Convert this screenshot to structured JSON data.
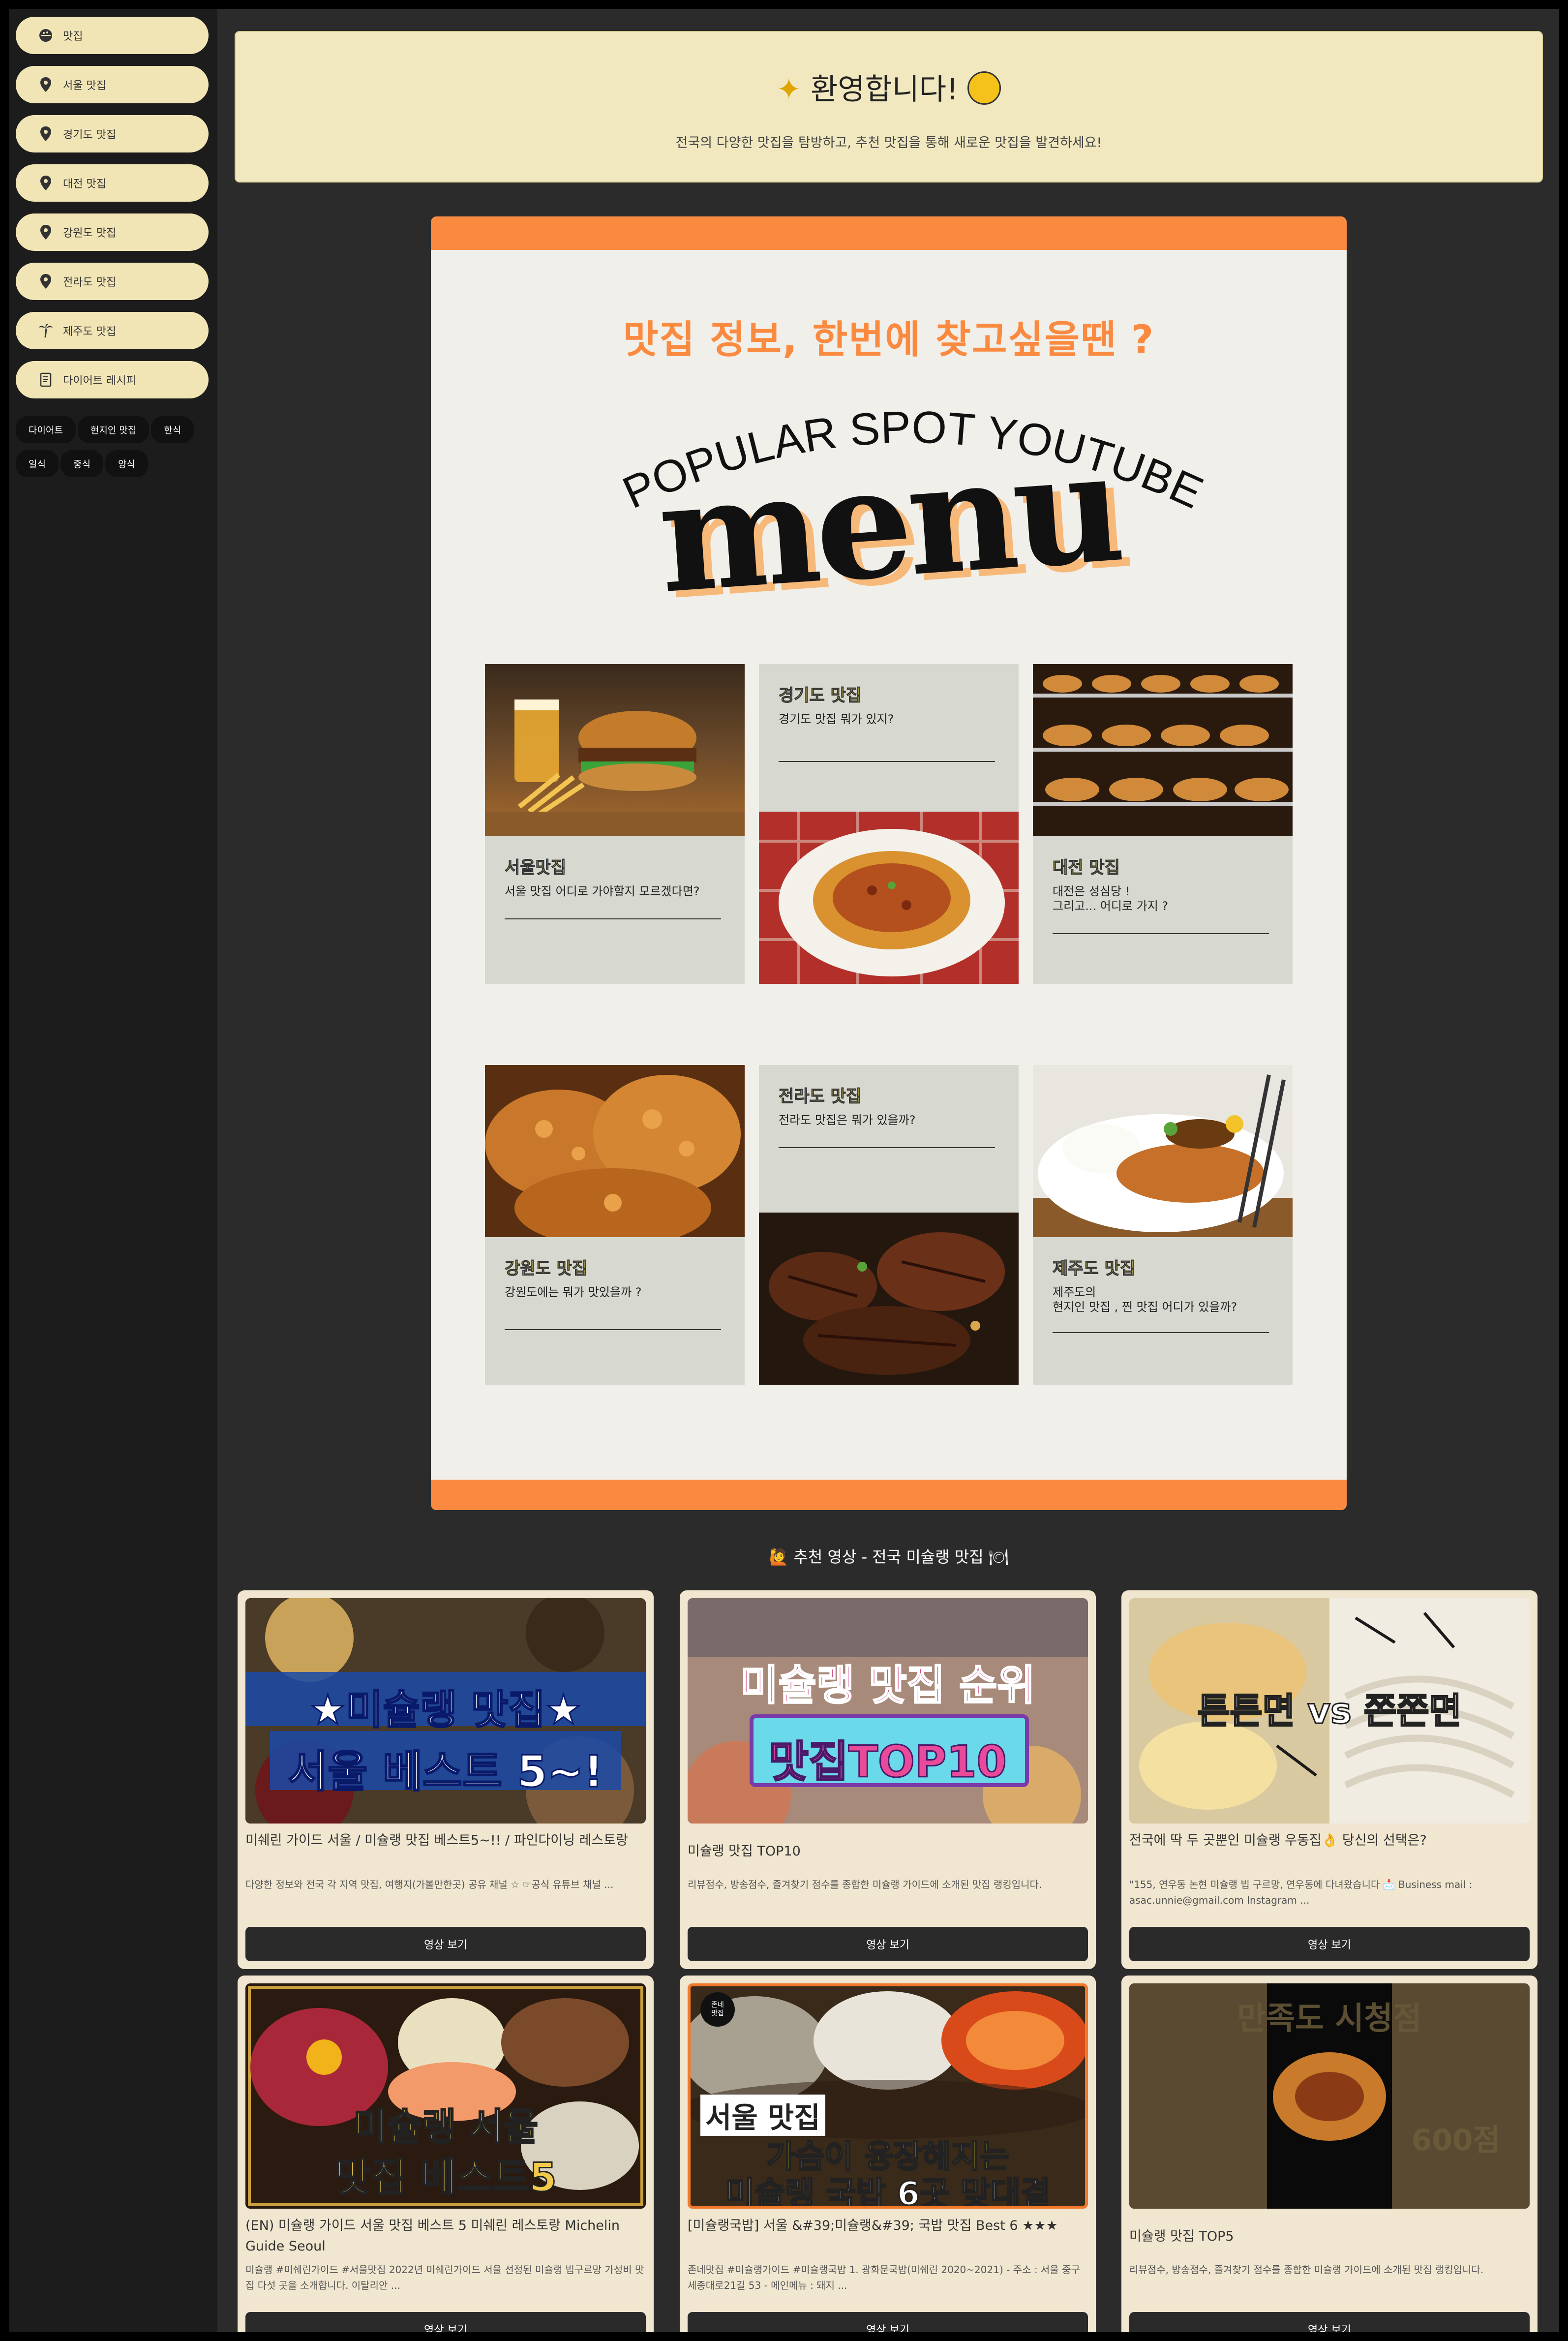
{
  "sidebar": {
    "items": [
      {
        "label": "맛집",
        "icon": "bowl-icon"
      },
      {
        "label": "서울 맛집",
        "icon": "location-pin-icon"
      },
      {
        "label": "경기도 맛집",
        "icon": "location-pin-icon"
      },
      {
        "label": "대전 맛집",
        "icon": "location-pin-icon"
      },
      {
        "label": "강원도 맛집",
        "icon": "location-pin-icon"
      },
      {
        "label": "전라도 맛집",
        "icon": "location-pin-icon"
      },
      {
        "label": "제주도 맛집",
        "icon": "palm-tree-icon"
      },
      {
        "label": "다이어트 레시피",
        "icon": "notebook-icon"
      }
    ],
    "tags": [
      "다이어트",
      "현지인 맛집",
      "한식",
      "일식",
      "중식",
      "양식"
    ]
  },
  "welcome": {
    "title": "환영합니다!",
    "subtitle": "전국의 다양한 맛집을 탐방하고, 추천 맛집을 통해 새로운 맛집을 발견하세요!"
  },
  "poster": {
    "headline": "맛집 정보, 한번에 찾고싶을땐 ?",
    "arc_text": "POPULAR SPOT YOUTUBE",
    "big_word": "menu",
    "tiles": [
      {
        "title": "서울맛집",
        "desc": "서울 맛집 어디로 가야할지 모르겠다면?"
      },
      {
        "title": "경기도 맛집",
        "desc": "경기도 맛집 뭐가 있지?"
      },
      {
        "title": "대전 맛집",
        "desc": "대전은 성심당 !\n그리고... 어디로 가지 ?"
      },
      {
        "title": "강원도 맛집",
        "desc": "강원도에는 뭐가 맛있을까 ?"
      },
      {
        "title": "전라도 맛집",
        "desc": "전라도 맛집은 뭐가 있을까?"
      },
      {
        "title": "제주도 맛집",
        "desc": "제주도의\n현지인 맛집 , 찐 맛집 어디가 있을까?"
      }
    ]
  },
  "section": {
    "title": "추천 영상 - 전국 미슐랭 맛집"
  },
  "videos": [
    {
      "title": "미쉐린 가이드 서울 / 미슐랭 맛집 베스트5~!! / 파인다이닝 레스토랑",
      "desc": "다양한 정보와 전국 각 지역 맛집, 여행지(가볼만한곳) 공유 채널 ☆ ☞공식 유튜브 채널 ...",
      "button": "영상 보기",
      "thumb_line1": "★미슐랭 맛집★",
      "thumb_line2": "서울 베스트 5~!"
    },
    {
      "title": "미슐랭 맛집 TOP10",
      "desc": "리뷰점수, 방송점수, 즐겨찾기 점수를 종합한 미슐랭 가이드에 소개된 맛집 랭킹입니다.",
      "button": "영상 보기",
      "thumb_line1": "미슐랭 맛집 순위",
      "thumb_line2": "맛집TOP10"
    },
    {
      "title": "전국에 딱 두 곳뿐인 미슐랭 우동집👌 당신의 선택은?",
      "desc": "\"155,  연우동 논현 미슐랭 빕 구르망, 연우동에 다녀왔습니다 📩 Business mail : asac.unnie@gmail.com Instagram ...",
      "button": "영상 보기",
      "thumb_line1": "튼튼면 vs 쫀쫀면",
      "thumb_line2": ""
    },
    {
      "title": "(EN) 미슐랭 가이드 서울 맛집 베스트 5 미쉐린 레스토랑 Michelin Guide Seoul",
      "desc": "미슐랭 #미쉐린가이드 #서울맛집 2022년 미쉐린가이드 서울 선정된 미슐랭 빕구르망 가성비 맛집 다섯 곳을 소개합니다. 이탈리안 ...",
      "button": "영상 보기",
      "thumb_line1": "미슐랭 서울",
      "thumb_line2": "맛집 베스트5"
    },
    {
      "title": "[미슐랭국밥] 서울 &#39;미슐랭&#39; 국밥 맛집 Best 6 ★★★",
      "desc": "존네맛집 #미슐랭가이드 #미슐랭국밥 1. 광화문국밥(미쉐린 2020~2021) - 주소 : 서울 중구 세종대로21길 53 - 메인메뉴 : 돼지 ...",
      "button": "영상 보기",
      "thumb_line1": "서울 맛집",
      "thumb_line2": "가슴이 웅장해지는",
      "thumb_line3": "미슐랭 국밥 6곳 맞대결",
      "thumb_badge": "존네\n맛집"
    },
    {
      "title": "미슐랭 맛집 TOP5",
      "desc": "리뷰점수, 방송점수, 즐겨찾기 점수를 종합한 미슐랭 가이드에 소개된 맛집 랭킹입니다.",
      "button": "영상 보기",
      "thumb_line1": "만족도 시청점",
      "thumb_line2": "600점"
    }
  ]
}
